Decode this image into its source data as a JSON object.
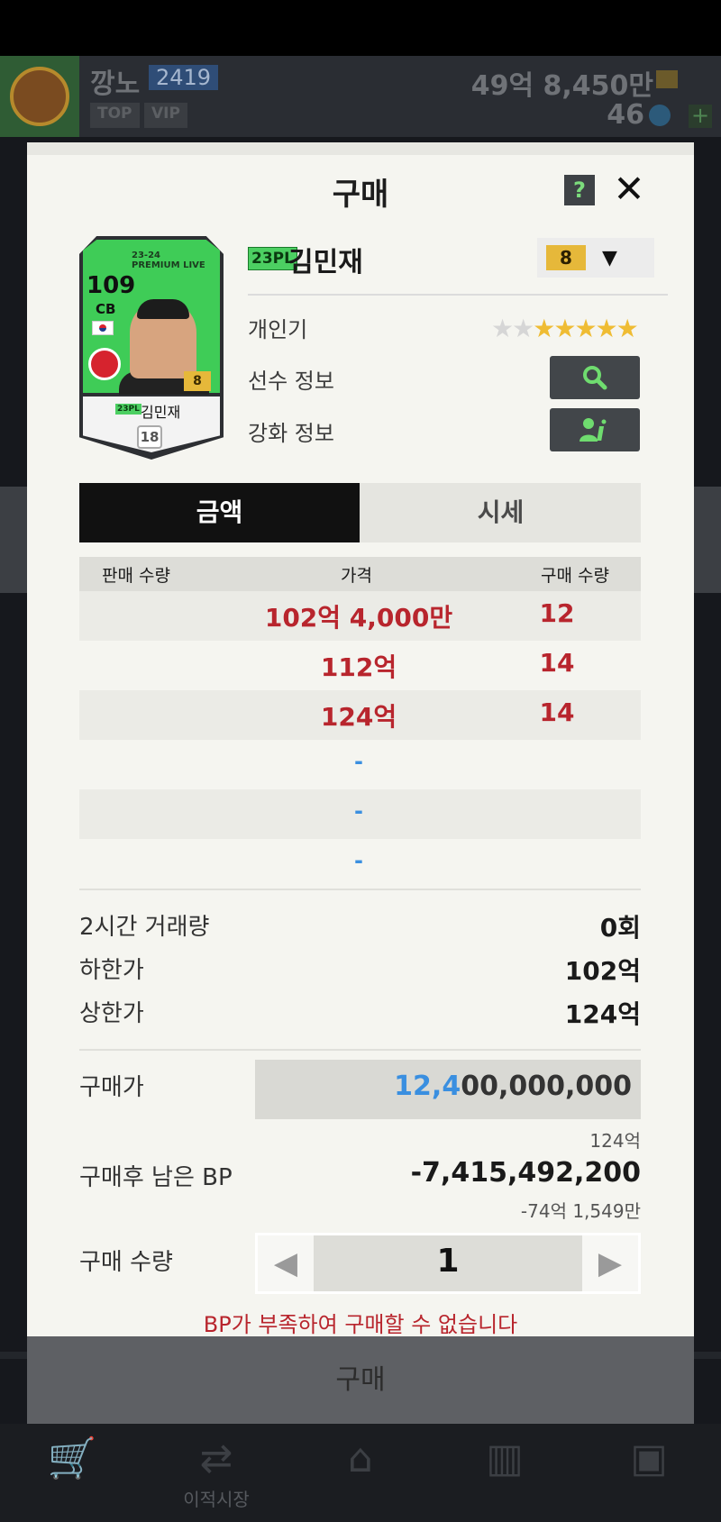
{
  "header": {
    "user_name": "깡노",
    "user_level": "2419",
    "tag_top": "TOP",
    "tag_vip": "VIP",
    "bp_amount": "49억 8,450만",
    "coin_amount": "46",
    "plus_label": "+"
  },
  "modal": {
    "title": "구매",
    "help_label": "?",
    "close_label": "✕"
  },
  "card": {
    "season_line1": "23-24",
    "season_line2": "PREMIUM LIVE",
    "ovr": "109",
    "position": "CB",
    "level": "8",
    "badge": "23PL",
    "name": "김민재",
    "shield": "18"
  },
  "player": {
    "season_badge": "23PL",
    "name": "김민재",
    "enhance_level": "8",
    "popularity_label": "개인기",
    "popularity_stars_filled": 5,
    "popularity_stars_total": 7,
    "info_label": "선수 정보",
    "enhance_label": "강화 정보"
  },
  "tabs": [
    {
      "label": "금액",
      "active": true
    },
    {
      "label": "시세",
      "active": false
    }
  ],
  "table": {
    "headers": [
      "판매 수량",
      "가격",
      "구매 수량"
    ],
    "rows": [
      {
        "price": "102억 4,000만",
        "qty": "12"
      },
      {
        "price": "112억",
        "qty": "14"
      },
      {
        "price": "124억",
        "qty": "14"
      },
      {
        "price": "-",
        "qty": ""
      },
      {
        "price": "-",
        "qty": ""
      },
      {
        "price": "-",
        "qty": ""
      }
    ]
  },
  "stats": {
    "volume_label": "2시간 거래량",
    "volume_value": "0회",
    "min_label": "하한가",
    "min_value": "102억",
    "max_label": "상한가",
    "max_value": "124억"
  },
  "purchase": {
    "price_label": "구매가",
    "price_highlight": "12,4",
    "price_rest": "00,000,000",
    "price_note": "124억",
    "remaining_label": "구매후 남은 BP",
    "remaining_value": "-7,415,492,200",
    "remaining_note": "-74억 1,549만",
    "qty_label": "구매 수량",
    "qty_value": "1",
    "error": "BP가 부족하여 구매할 수 없습니다",
    "buy_button": "구매"
  },
  "nav": {
    "transfer_label": "이적시장"
  },
  "colors": {
    "accent_red": "#b8252d",
    "accent_blue": "#3a8fe0",
    "star_gold": "#efbc33",
    "card_green": "#3fcc57"
  }
}
